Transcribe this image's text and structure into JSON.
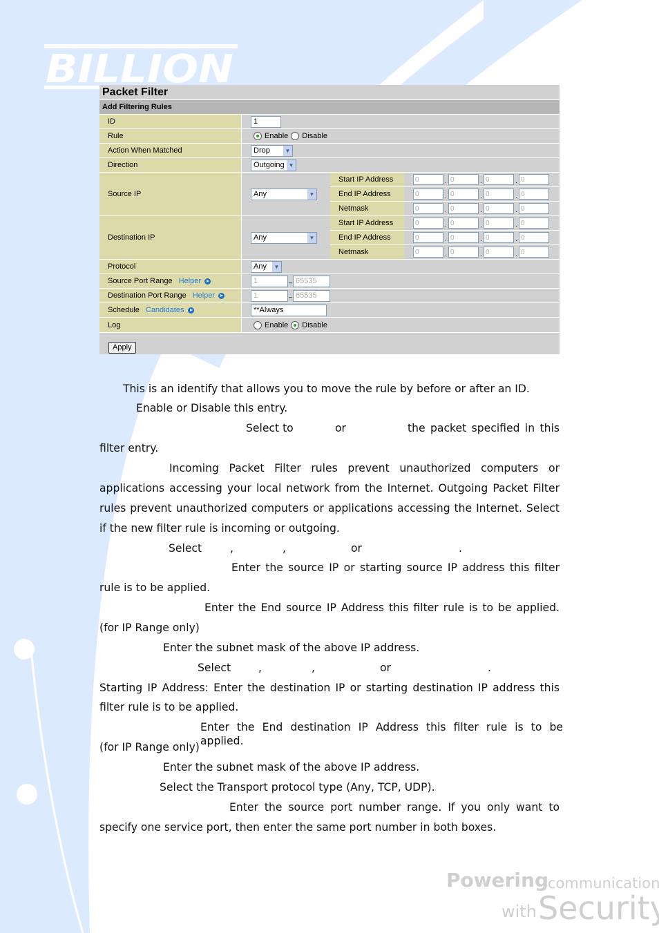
{
  "brand": {
    "logo": "BILLION",
    "tagline_1": "Powering",
    "tagline_2": "communications",
    "tagline_3": "with",
    "tagline_4": "Security"
  },
  "form": {
    "title": "Packet Filter",
    "subtitle": "Add Filtering Rules",
    "id": {
      "label": "ID",
      "value": "1"
    },
    "rule": {
      "label": "Rule",
      "enable": "Enable",
      "disable": "Disable",
      "selected": "Enable"
    },
    "action": {
      "label": "Action When Matched",
      "value": "Drop"
    },
    "direction": {
      "label": "Direction",
      "value": "Outgoing"
    },
    "source_ip": {
      "label": "Source IP",
      "type": "Any",
      "start": "Start IP Address",
      "end": "End IP Address",
      "mask": "Netmask",
      "octet": "0"
    },
    "dest_ip": {
      "label": "Destination IP",
      "type": "Any",
      "start": "Start IP Address",
      "end": "End IP Address",
      "mask": "Netmask",
      "octet": "0"
    },
    "protocol": {
      "label": "Protocol",
      "value": "Any"
    },
    "src_port": {
      "label": "Source Port Range",
      "helper": "Helper",
      "from": "1",
      "to": "65535"
    },
    "dst_port": {
      "label": "Destination Port Range",
      "helper": "Helper",
      "from": "1",
      "to": "65535"
    },
    "schedule": {
      "label": "Schedule",
      "candidates": "Candidates",
      "value": "**Always"
    },
    "log": {
      "label": "Log",
      "enable": "Enable",
      "disable": "Disable",
      "selected": "Disable"
    },
    "apply": "Apply"
  },
  "body": [
    "This is an identify that allows you to move the rule by before or after an ID.",
    "Enable or Disable this entry.",
    "Select to",
    "or",
    "the packet specified in this",
    "filter entry.",
    "Incoming Packet Filter rules prevent unauthorized computers or",
    "applications accessing your local network from the Internet. Outgoing Packet Filter",
    "rules prevent unauthorized computers or applications accessing the Internet. Select",
    "if the new filter rule is incoming or outgoing.",
    "Select",
    ",",
    ",",
    "or",
    ".",
    "Enter the source IP or starting source IP address this filter",
    "rule is to be applied.",
    "Enter the End source IP Address this filter rule is to be applied.",
    "(for IP Range only)",
    "Enter the subnet mask of the above IP address.",
    "Select",
    ",",
    ",",
    "or",
    ".",
    "Starting IP Address: Enter the destination IP or starting destination IP address this",
    "filter rule is to be applied.",
    "Enter the End destination IP Address this filter rule is to be applied.",
    "(for IP Range only)",
    "Enter the subnet mask of the above IP address.",
    "Select the Transport protocol type (Any, TCP, UDP).",
    "Enter the source port number range. If you only want to",
    "specify one service port, then enter the same port number in both boxes."
  ]
}
